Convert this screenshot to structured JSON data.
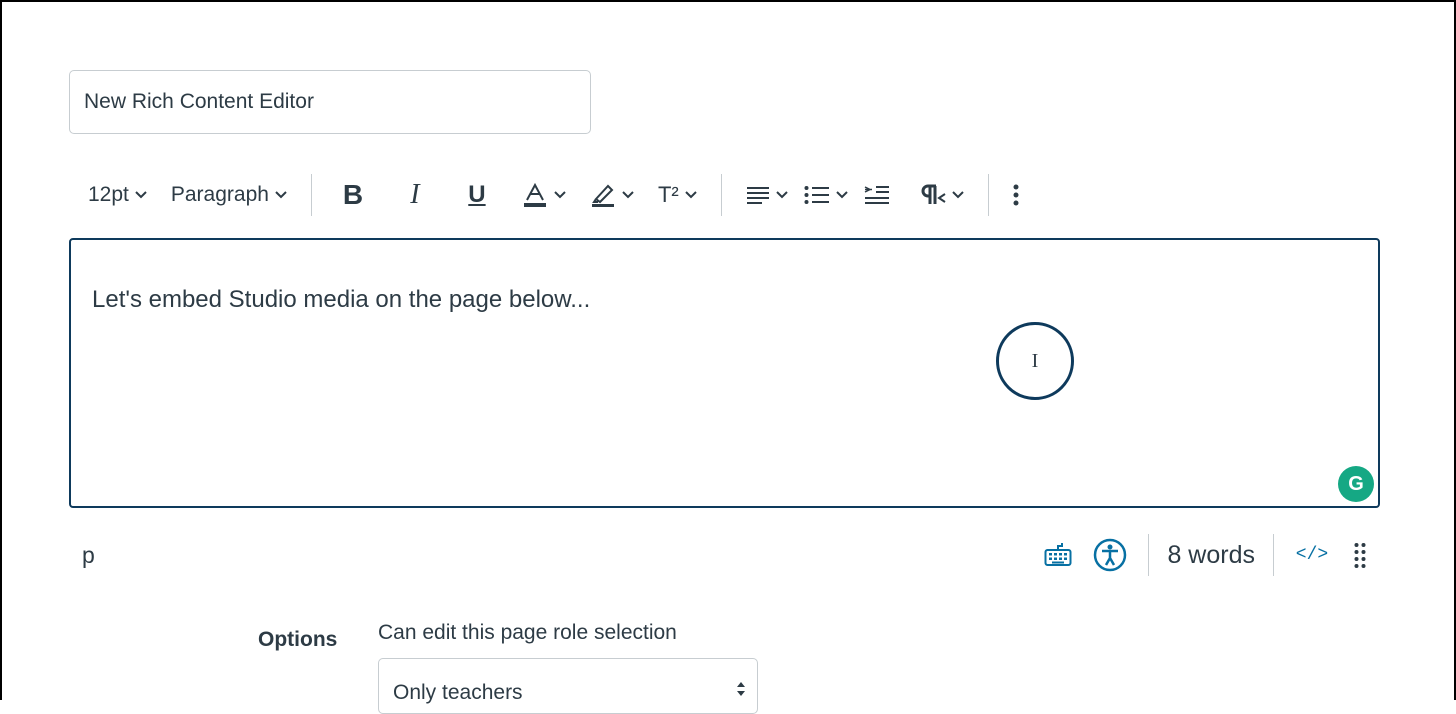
{
  "page": {
    "title_value": "New Rich Content Editor"
  },
  "toolbar": {
    "font_size": "12pt",
    "block_format": "Paragraph",
    "bold": "B",
    "italic": "I",
    "underline": "U",
    "superscript": "T²"
  },
  "editor": {
    "content": "Let's embed Studio media on the page below...",
    "cursor_glyph": "I",
    "grammarly_letter": "G"
  },
  "statusbar": {
    "element_path": "p",
    "word_count": "8 words",
    "html_toggle": "</>"
  },
  "options": {
    "label": "Options",
    "role_label": "Can edit this page role selection",
    "role_selected": "Only teachers"
  },
  "colors": {
    "accent": "#0770a3",
    "editor_border": "#0e3a5c",
    "grammarly": "#15a884",
    "text": "#2d3b45"
  }
}
